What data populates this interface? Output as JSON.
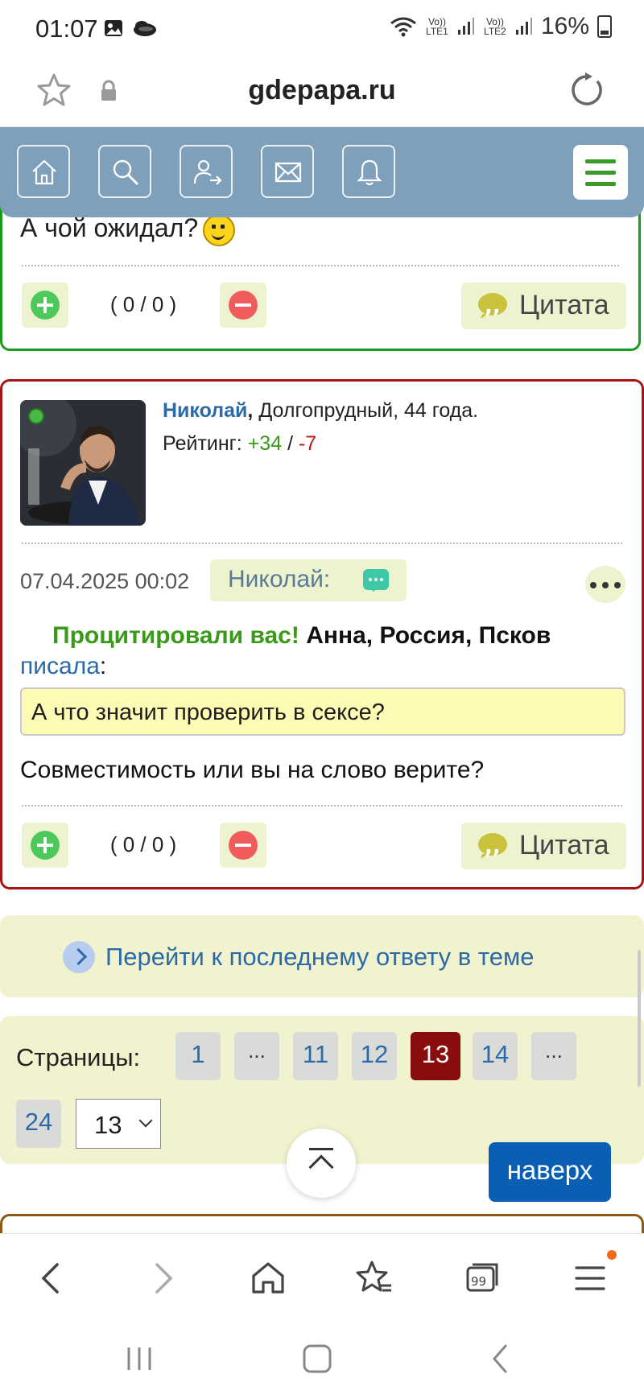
{
  "status_bar": {
    "time": "01:07",
    "battery": "16%",
    "sim1_label": "Vo)) LTE1",
    "sim2_label": "Vo)) LTE2",
    "icons": [
      "image-icon",
      "weather-icon",
      "wifi-icon",
      "signal-icon",
      "battery-icon"
    ]
  },
  "url_bar": {
    "domain": "gdepapa.ru",
    "icons": [
      "star-icon",
      "lock-icon",
      "reload-icon"
    ]
  },
  "site_nav": {
    "buttons": [
      "home-icon",
      "search-icon",
      "logout-icon",
      "mail-icon",
      "bell-icon",
      "hamburger-menu-icon"
    ],
    "accent": "#7fa0bb"
  },
  "post_prev": {
    "text": "А чой ожидал?",
    "score": "( 0 / 0 )",
    "quote_label": "Цитата",
    "border_color": "#1a9a1a"
  },
  "post": {
    "user_name": "Николай",
    "user_info": "Долгопрудный, 44 года.",
    "rating_label": "Рейтинг:",
    "rating_plus": "+34",
    "rating_sep": "/",
    "rating_minus": "-7",
    "date": "07.04.2025 00:02",
    "address_chip": "Николай:",
    "cited_notice": "Процитировали вас!",
    "cited_author": "Анна, Россия, Псков",
    "cited_link": "писала",
    "cited_colon": ":",
    "quote_text": "А что значит проверить в сексе?",
    "reply_text": "Совместимость или вы на слово верите?",
    "score": "( 0 / 0 )",
    "quote_label": "Цитата",
    "border_color": "#a51414"
  },
  "goto_last": {
    "label": "Перейти к последнему ответу в теме"
  },
  "pagination": {
    "label": "Страницы:",
    "pages": [
      "1",
      "...",
      "11",
      "12",
      "13",
      "14",
      "...",
      "24"
    ],
    "current": "13",
    "select_value": "13"
  },
  "scroll_top_label": "наверх",
  "browser_bar": {
    "icons": [
      "back-icon",
      "forward-icon",
      "home-icon",
      "bookmarks-icon",
      "tabs-icon",
      "menu-icon"
    ],
    "tabs_count": "99"
  },
  "system_nav": {
    "icons": [
      "recents-icon",
      "home-icon",
      "back-icon"
    ]
  }
}
